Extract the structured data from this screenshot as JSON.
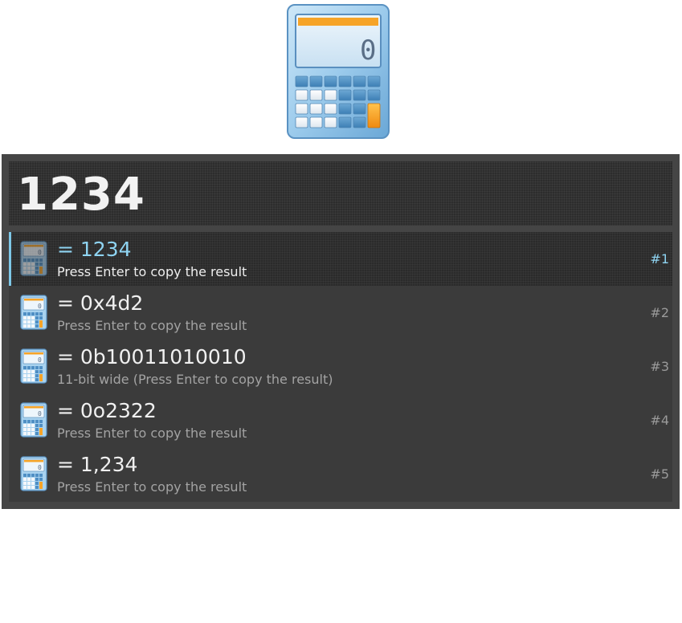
{
  "app_icon": {
    "icon": "calculator-icon",
    "display_digit": "0"
  },
  "query": {
    "text": "1234"
  },
  "results": [
    {
      "title": "= 1234",
      "subtitle": "Press Enter to copy the result",
      "hotkey": "#1",
      "selected": true,
      "icon": "calculator-icon"
    },
    {
      "title": "= 0x4d2",
      "subtitle": "Press Enter to copy the result",
      "hotkey": "#2",
      "selected": false,
      "icon": "calculator-icon"
    },
    {
      "title": "= 0b10011010010",
      "subtitle": "11-bit wide (Press Enter to copy the result)",
      "hotkey": "#3",
      "selected": false,
      "icon": "calculator-icon"
    },
    {
      "title": "= 0o2322",
      "subtitle": "Press Enter to copy the result",
      "hotkey": "#4",
      "selected": false,
      "icon": "calculator-icon"
    },
    {
      "title": "= 1,234",
      "subtitle": "Press Enter to copy the result",
      "hotkey": "#5",
      "selected": false,
      "icon": "calculator-icon"
    }
  ],
  "colors": {
    "panel": "#454545",
    "query_bg": "#2d2d2d",
    "results_bg": "#3b3b3b",
    "accent": "#8fd4f2",
    "calc_orange": "#f6a428"
  }
}
